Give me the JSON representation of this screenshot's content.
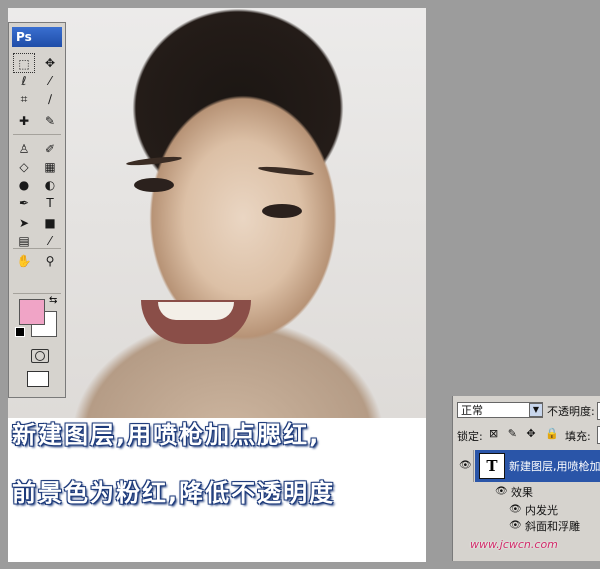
{
  "toolbox": {
    "app_label": "Ps",
    "foreground_color": "#f0a4c6",
    "background_color": "#ffffff",
    "tools": [
      {
        "name": "marquee-tool",
        "glyph": "⬚"
      },
      {
        "name": "move-tool",
        "glyph": "✥"
      },
      {
        "name": "lasso-tool",
        "glyph": "ℓ"
      },
      {
        "name": "magic-wand-tool",
        "glyph": "⁄"
      },
      {
        "name": "crop-tool",
        "glyph": "⌗"
      },
      {
        "name": "slice-tool",
        "glyph": "∕"
      },
      {
        "name": "healing-brush-tool",
        "glyph": "✚"
      },
      {
        "name": "brush-tool",
        "glyph": "✎"
      },
      {
        "name": "clone-stamp-tool",
        "glyph": "♙"
      },
      {
        "name": "history-brush-tool",
        "glyph": "✐"
      },
      {
        "name": "eraser-tool",
        "glyph": "◇"
      },
      {
        "name": "gradient-tool",
        "glyph": "▦"
      },
      {
        "name": "blur-tool",
        "glyph": "●"
      },
      {
        "name": "dodge-tool",
        "glyph": "◐"
      },
      {
        "name": "pen-tool",
        "glyph": "✒"
      },
      {
        "name": "type-tool",
        "glyph": "T"
      },
      {
        "name": "path-selection-tool",
        "glyph": "➤"
      },
      {
        "name": "rectangle-tool",
        "glyph": "■"
      },
      {
        "name": "notes-tool",
        "glyph": "▤"
      },
      {
        "name": "eyedropper-tool",
        "glyph": "⁄"
      },
      {
        "name": "hand-tool",
        "glyph": "✋"
      },
      {
        "name": "zoom-tool",
        "glyph": "⚲"
      }
    ]
  },
  "caption": {
    "line1": "新建图层,用喷枪加点腮红,",
    "line2": "前景色为粉红,降低不透明度"
  },
  "layers_panel": {
    "blend_mode": "正常",
    "opacity_label": "不透明度:",
    "lock_label": "锁定:",
    "lock_icons": "⊠ ✎ ✥ 🔒",
    "fill_label": "填充:",
    "layer": {
      "thumb": "T",
      "name": "新建图层,用喷枪加"
    },
    "effects_label": "效果",
    "effects": [
      "内发光",
      "斜面和浮雕"
    ]
  },
  "watermark": "www.jcwcn.com"
}
